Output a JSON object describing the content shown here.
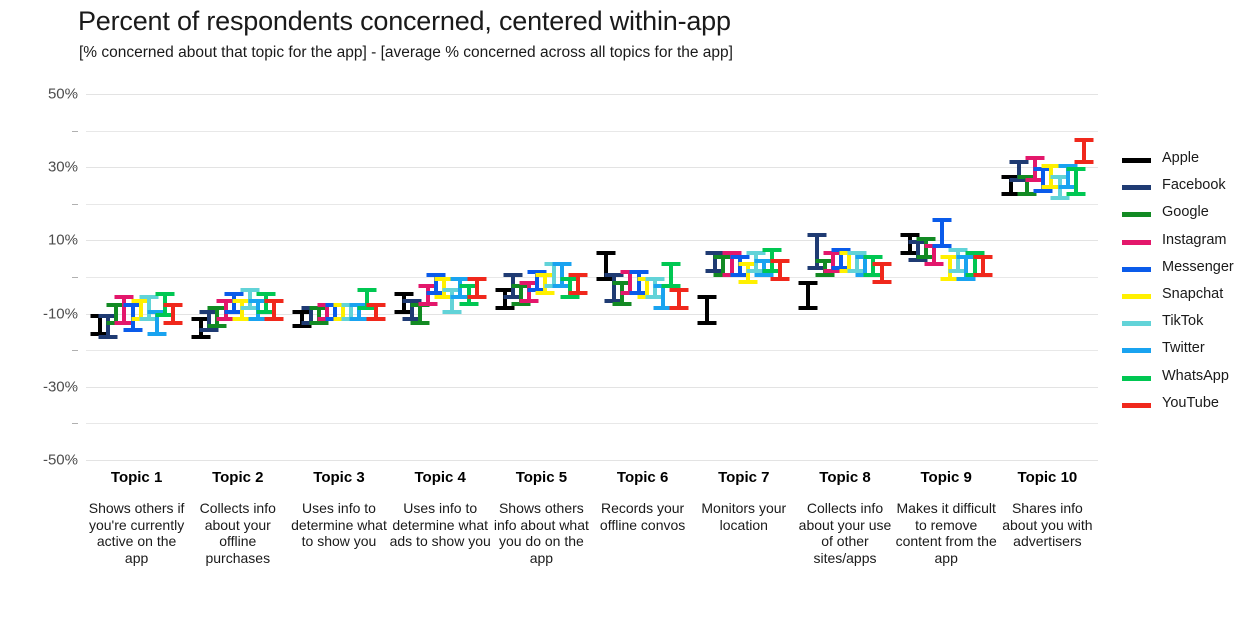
{
  "chart_data": {
    "type": "bar",
    "title": "Percent of respondents concerned, centered within-app",
    "subtitle": "[% concerned about that topic for the app] - [average % concerned across all topics for the app]",
    "xlabel": "",
    "ylabel": "",
    "ylim": [
      -50,
      50
    ],
    "ytick_step": 20,
    "gridline_step": 10,
    "grid": true,
    "legend_position": "right",
    "ytick_labels": [
      "50%",
      "30%",
      "10%",
      "-10%",
      "-30%",
      "-50%"
    ],
    "ytick_values": [
      50,
      30,
      10,
      -10,
      -30,
      -50
    ],
    "categories": [
      "Topic 1",
      "Topic 2",
      "Topic 3",
      "Topic 4",
      "Topic 5",
      "Topic 6",
      "Topic 7",
      "Topic 8",
      "Topic 9",
      "Topic 10"
    ],
    "category_descriptions": [
      "Shows others if you're currently active on the app",
      "Collects info about your offline purchases",
      "Uses info to determine what to show you",
      "Uses info to determine what ads to show you",
      "Shows others info about what you do on the app",
      "Records your offline convos",
      "Monitors your location",
      "Collects info about your use of other sites/apps",
      "Makes it difficult to remove content from the app",
      "Shares info about you with advertisers"
    ],
    "legend_entries": [
      "Apple",
      "Facebook",
      "Google",
      "Instagram",
      "Messenger",
      "Snapchat",
      "TikTok",
      "Twitter",
      "WhatsApp",
      "YouTube"
    ],
    "colors": {
      "Apple": "#000000",
      "Facebook": "#1f3b73",
      "Google": "#128a23",
      "Instagram": "#e3176b",
      "Messenger": "#0a5bea",
      "Snapchat": "#fff000",
      "TikTok": "#62d3d8",
      "Twitter": "#19a3f0",
      "WhatsApp": "#00c752",
      "YouTube": "#f0281c"
    },
    "value_type": "interval",
    "note": "Each mark is an error bar: low and high bounds in percentage points centered within app.",
    "series": [
      {
        "name": "Apple",
        "low": [
          -16,
          -17,
          -14,
          -10,
          -9,
          -1,
          -13,
          -9,
          6,
          22
        ],
        "high": [
          -10,
          -11,
          -9,
          -4,
          -3,
          7,
          -5,
          -1,
          12,
          28
        ]
      },
      {
        "name": "Facebook",
        "low": [
          -17,
          -15,
          -13,
          -12,
          -6,
          -7,
          1,
          2,
          4,
          26
        ],
        "high": [
          -10,
          -9,
          -8,
          -6,
          1,
          1,
          7,
          12,
          10,
          32
        ]
      },
      {
        "name": "Google",
        "low": [
          -13,
          -14,
          -13,
          -13,
          -8,
          -8,
          0,
          0,
          5,
          22
        ],
        "high": [
          -7,
          -8,
          -8,
          -7,
          -2,
          -1,
          6,
          5,
          11,
          28
        ]
      },
      {
        "name": "Instagram",
        "low": [
          -13,
          -12,
          -12,
          -8,
          -7,
          -5,
          0,
          1,
          3,
          26
        ],
        "high": [
          -5,
          -6,
          -7,
          -2,
          -1,
          2,
          7,
          7,
          9,
          33
        ]
      },
      {
        "name": "Messenger",
        "low": [
          -15,
          -10,
          -12,
          -5,
          -4,
          -5,
          0,
          2,
          8,
          23
        ],
        "high": [
          -7,
          -4,
          -7,
          1,
          2,
          2,
          6,
          8,
          16,
          30
        ]
      },
      {
        "name": "Snapchat",
        "low": [
          -12,
          -12,
          -12,
          -6,
          -5,
          -6,
          -2,
          1,
          -1,
          24
        ],
        "high": [
          -6,
          -6,
          -7,
          0,
          1,
          0,
          4,
          7,
          6,
          31
        ]
      },
      {
        "name": "TikTok",
        "low": [
          -12,
          -9,
          -12,
          -10,
          -3,
          -6,
          1,
          1,
          1,
          21
        ],
        "high": [
          -5,
          -3,
          -7,
          -3,
          4,
          0,
          7,
          7,
          8,
          28
        ]
      },
      {
        "name": "Twitter",
        "low": [
          -16,
          -12,
          -12,
          -6,
          -3,
          -9,
          0,
          0,
          -1,
          24
        ],
        "high": [
          -9,
          -6,
          -7,
          0,
          4,
          -2,
          5,
          6,
          6,
          31
        ]
      },
      {
        "name": "WhatsApp",
        "low": [
          -11,
          -10,
          -9,
          -8,
          -6,
          -3,
          1,
          0,
          0,
          22
        ],
        "high": [
          -4,
          -4,
          -3,
          -2,
          0,
          4,
          8,
          6,
          7,
          30
        ]
      },
      {
        "name": "YouTube",
        "low": [
          -13,
          -12,
          -12,
          -6,
          -5,
          -9,
          -1,
          -2,
          0,
          31
        ],
        "high": [
          -7,
          -6,
          -7,
          0,
          1,
          -3,
          5,
          4,
          6,
          38
        ]
      }
    ]
  }
}
